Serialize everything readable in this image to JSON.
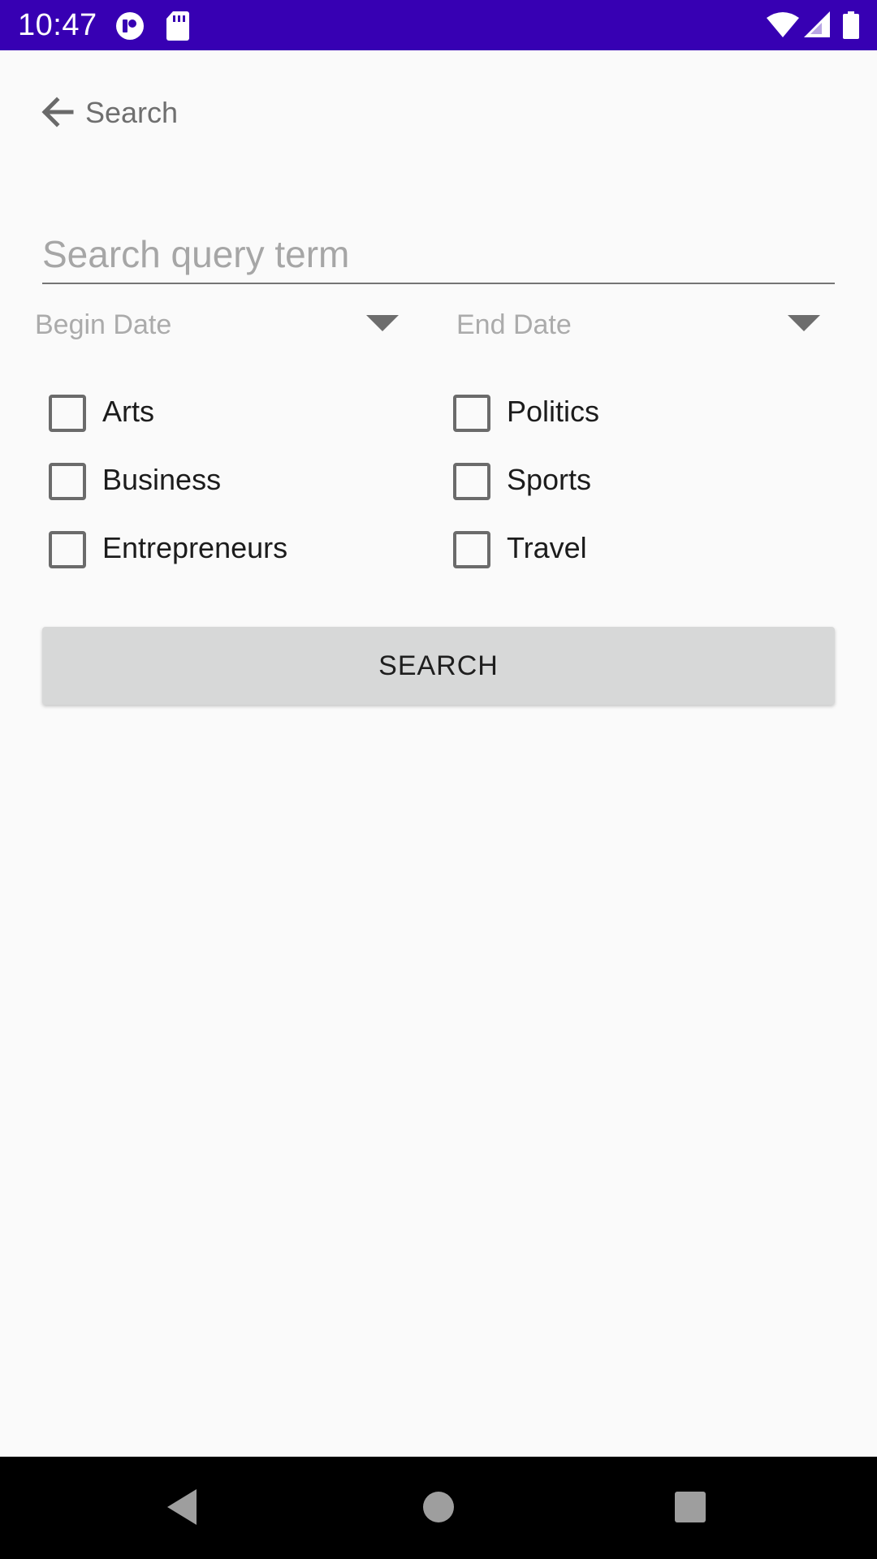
{
  "status_bar": {
    "time": "10:47",
    "background_color": "#3700b3",
    "left_icons": [
      "app-notification-icon",
      "sd-card-icon"
    ],
    "right_icons": [
      "wifi-icon",
      "cellular-signal-icon",
      "battery-icon"
    ]
  },
  "toolbar": {
    "back_icon": "arrow-back-icon",
    "title": "Search"
  },
  "search": {
    "placeholder": "Search query term",
    "value": ""
  },
  "dates": {
    "begin": {
      "label": "Begin Date",
      "icon": "dropdown-triangle-icon"
    },
    "end": {
      "label": "End Date",
      "icon": "dropdown-triangle-icon"
    }
  },
  "categories": [
    {
      "label": "Arts",
      "checked": false
    },
    {
      "label": "Politics",
      "checked": false
    },
    {
      "label": "Business",
      "checked": false
    },
    {
      "label": "Sports",
      "checked": false
    },
    {
      "label": "Entrepreneurs",
      "checked": false
    },
    {
      "label": "Travel",
      "checked": false
    }
  ],
  "search_button": {
    "label": "SEARCH"
  },
  "nav_bar": {
    "icons": [
      "nav-back-icon",
      "nav-home-icon",
      "nav-recents-icon"
    ]
  }
}
